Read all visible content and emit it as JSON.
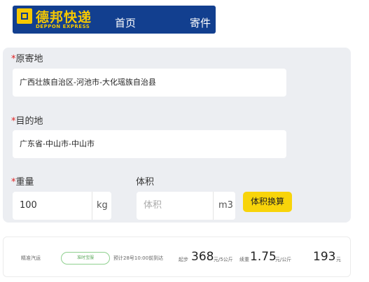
{
  "header": {
    "logo_cn": "德邦快递",
    "logo_en": "DEPPON EXPRESS",
    "nav": [
      {
        "label": "首页"
      },
      {
        "label": "寄件"
      }
    ]
  },
  "form": {
    "origin": {
      "required_mark": "*",
      "label": "原寄地",
      "value": "广西壮族自治区-河池市-大化瑶族自治县"
    },
    "destination": {
      "required_mark": "*",
      "label": "目的地",
      "value": "广东省-中山市-中山市"
    },
    "weight": {
      "required_mark": "*",
      "label": "重量",
      "value": "100",
      "unit": "kg"
    },
    "volume": {
      "label": "体积",
      "placeholder": "体积",
      "unit": "m3"
    },
    "calc_button": "体积换算"
  },
  "result": {
    "product": "精准汽运",
    "pill": "准时宝服",
    "eta": "预计28号10:00前到达",
    "first_label": "起步",
    "first_value": "368",
    "first_unit": "元/5公斤",
    "rate_label": "续重",
    "rate_value": "1.75",
    "rate_unit": "元/公斤",
    "total_value": "193",
    "total_unit": "元"
  },
  "colors": {
    "brand_blue": "#123f8f",
    "brand_yellow": "#f6c800",
    "button_yellow": "#f8d40a",
    "required_red": "#e02020"
  }
}
